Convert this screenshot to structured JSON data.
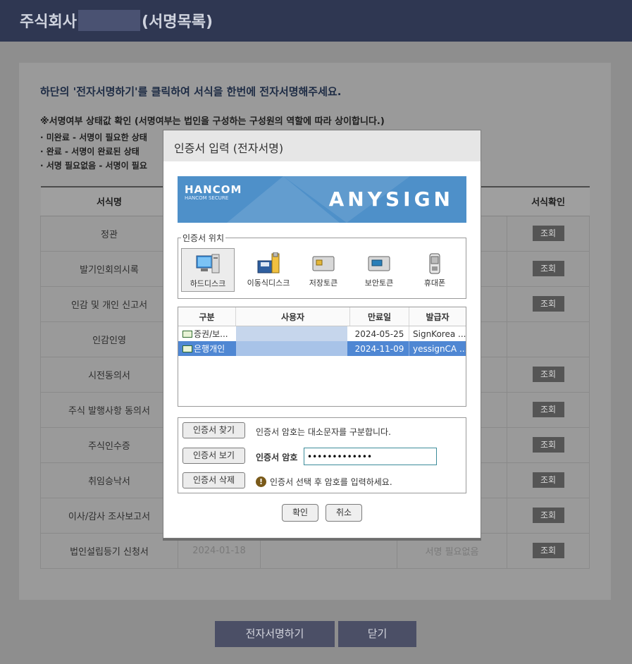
{
  "header": {
    "title_prefix": "주식회사",
    "title_suffix": "(서명목록)"
  },
  "panel": {
    "headline": "하단의 '전자서명하기'를 클릭하여 서식을 한번에 전자서명해주세요.",
    "notice": "※서명여부 상태값 확인 (서명여부는 법인을 구성하는 구성원의 역할에 따라 상이합니다.)",
    "status_lines": [
      "· 미완료 - 서명이 필요한 상태",
      "· 완료 - 서명이 완료된 상태",
      "· 서명 필요없음 - 서명이 필요"
    ]
  },
  "table": {
    "headers": [
      "서식명",
      "",
      "",
      "",
      "서식확인"
    ],
    "rows": [
      {
        "name": "정관",
        "date": "",
        "status": "",
        "view": "조회"
      },
      {
        "name": "발기인회의시록",
        "date": "",
        "status": "",
        "view": "조회"
      },
      {
        "name": "인감 및 개인 신고서",
        "date": "",
        "status": "",
        "view": "조회"
      },
      {
        "name": "인감인영",
        "date": "",
        "status": "",
        "view": ""
      },
      {
        "name": "시전동의서",
        "date": "",
        "status": "",
        "view": "조회"
      },
      {
        "name": "주식 발행사항 동의서",
        "date": "",
        "status": "",
        "view": "조회"
      },
      {
        "name": "주식인수증",
        "date": "",
        "status": "",
        "view": "조회"
      },
      {
        "name": "취임승낙서",
        "date": "",
        "status": "",
        "view": "조회"
      },
      {
        "name": "이사/감사 조사보고서",
        "date": "",
        "status": "",
        "view": "조회"
      },
      {
        "name": "법인설립등기 신청서",
        "date": "2024-01-18",
        "status": "서명 필요없음",
        "view": "조회"
      }
    ]
  },
  "footer": {
    "sign_label": "전자서명하기",
    "close_label": "닫기"
  },
  "dialog": {
    "title": "인증서 입력 (전자서명)",
    "banner": {
      "logo": "HANCOM",
      "logo_sub": "HANCOM SECURE",
      "brand": "ANYSIGN"
    },
    "location_legend": "인증서 위치",
    "media": [
      {
        "label": "하드디스크",
        "icon": "hard-disk-icon",
        "selected": true
      },
      {
        "label": "이동식디스크",
        "icon": "removable-disk-icon",
        "selected": false
      },
      {
        "label": "저장토큰",
        "icon": "storage-token-icon",
        "selected": false
      },
      {
        "label": "보안토큰",
        "icon": "security-token-icon",
        "selected": false
      },
      {
        "label": "휴대폰",
        "icon": "mobile-phone-icon",
        "selected": false
      }
    ],
    "cert_headers": [
      "구분",
      "사용자",
      "만료일",
      "발급자"
    ],
    "certs": [
      {
        "type": "증권/보...",
        "expiry": "2024-05-25",
        "issuer": "SignKorea ...",
        "selected": false
      },
      {
        "type": "은행개인",
        "expiry": "2024-11-09",
        "issuer": "yessignCA ...",
        "selected": true
      }
    ],
    "buttons": {
      "find": "인증서 찾기",
      "view": "인증서 보기",
      "delete": "인증서 삭제"
    },
    "case_info": "인증서 암호는 대소문자를 구분합니다.",
    "password_label": "인증서 암호",
    "password_value": "•••••••••••••",
    "warning": "인증서 선택 후 암호를 입력하세요.",
    "ok_label": "확인",
    "cancel_label": "취소"
  }
}
